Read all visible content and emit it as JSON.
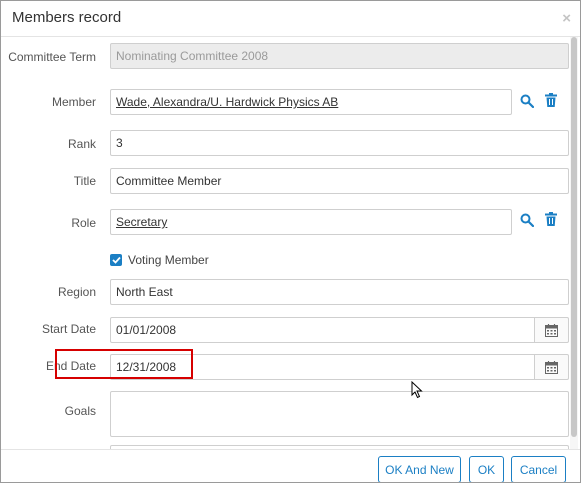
{
  "dialog": {
    "title": "Members record",
    "close_glyph": "×"
  },
  "form": {
    "committee_term": {
      "label": "Committee Term",
      "value": "Nominating Committee 2008"
    },
    "member": {
      "label": "Member",
      "value": "Wade, Alexandra/U. Hardwick Physics AB"
    },
    "rank": {
      "label": "Rank",
      "value": "3"
    },
    "title": {
      "label": "Title",
      "value": "Committee Member"
    },
    "role": {
      "label": "Role",
      "value": "Secretary"
    },
    "voting_member": {
      "label": "Voting Member",
      "checked": true
    },
    "region": {
      "label": "Region",
      "value": "North East"
    },
    "start_date": {
      "label": "Start Date",
      "value": "01/01/2008"
    },
    "end_date": {
      "label": "End Date",
      "value": "12/31/2008"
    },
    "goals": {
      "label": "Goals",
      "value": ""
    }
  },
  "footer": {
    "ok_and_new_label": "OK And New",
    "ok_label": "OK",
    "cancel_label": "Cancel"
  },
  "colors": {
    "accent": "#1b7fc4",
    "highlight": "#d60000",
    "disabled_bg": "#ececec"
  },
  "icons": [
    "search-icon",
    "trash-icon",
    "calendar-icon",
    "check-icon",
    "close-icon"
  ]
}
